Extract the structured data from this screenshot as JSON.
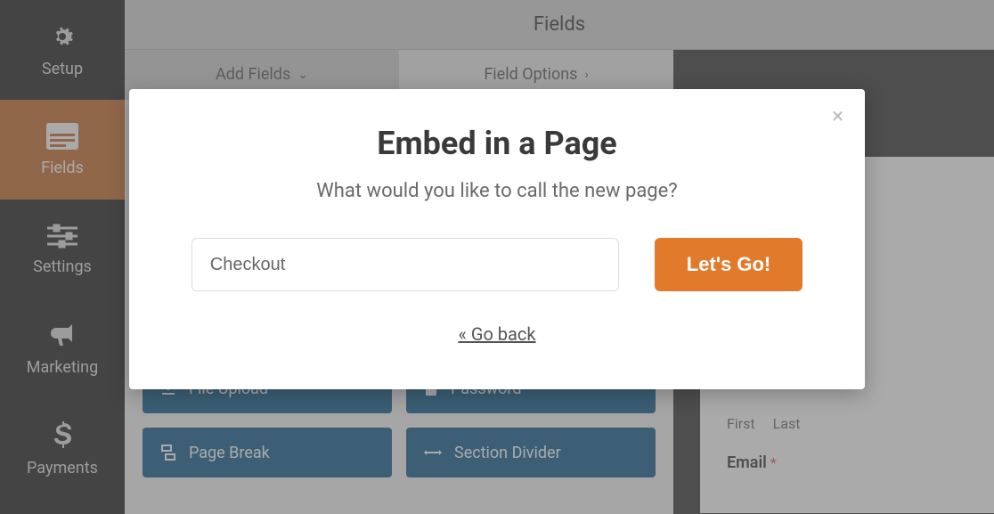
{
  "sidebar": {
    "items": [
      {
        "label": "Setup"
      },
      {
        "label": "Fields"
      },
      {
        "label": "Settings"
      },
      {
        "label": "Marketing"
      },
      {
        "label": "Payments"
      }
    ]
  },
  "header": {
    "title": "Fields"
  },
  "tabs": {
    "add": "Add Fields",
    "options": "Field Options"
  },
  "fieldButtons": {
    "fileUpload": "File Upload",
    "password": "Password",
    "pageBreak": "Page Break",
    "sectionDivider": "Section Divider"
  },
  "preview": {
    "first": "First",
    "last": "Last",
    "email": "Email",
    "required": "*"
  },
  "modal": {
    "title": "Embed in a Page",
    "subtitle": "What would you like to call the new page?",
    "input_value": "Checkout",
    "submit": "Let's Go!",
    "back": "« Go back",
    "close": "×"
  }
}
